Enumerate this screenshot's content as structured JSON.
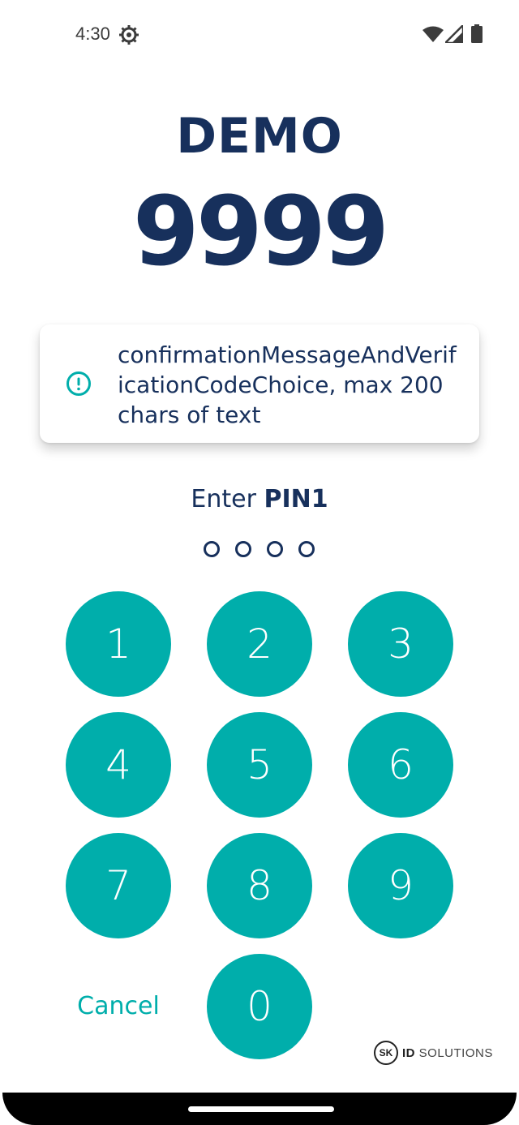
{
  "status_bar": {
    "time": "4:30",
    "icons": [
      "settings-icon",
      "wifi-icon",
      "signal-icon",
      "battery-icon"
    ]
  },
  "header": {
    "title": "DEMO",
    "verification_code": "9999"
  },
  "message": {
    "icon": "info-icon",
    "text": "confirmationMessageAndVerificationCodeChoice, max 200 chars of text"
  },
  "pin_prompt": {
    "prefix": "Enter",
    "pin_name": "PIN1",
    "length": 4,
    "entered": 0
  },
  "keypad": {
    "keys": [
      "1",
      "2",
      "3",
      "4",
      "5",
      "6",
      "7",
      "8",
      "9",
      "0"
    ],
    "cancel_label": "Cancel"
  },
  "brand": {
    "logo_text": "SK",
    "name_bold": "ID",
    "name_rest": "SOLUTIONS"
  },
  "colors": {
    "primary_navy": "#17305c",
    "accent_teal": "#00aeab",
    "background": "#ffffff"
  }
}
